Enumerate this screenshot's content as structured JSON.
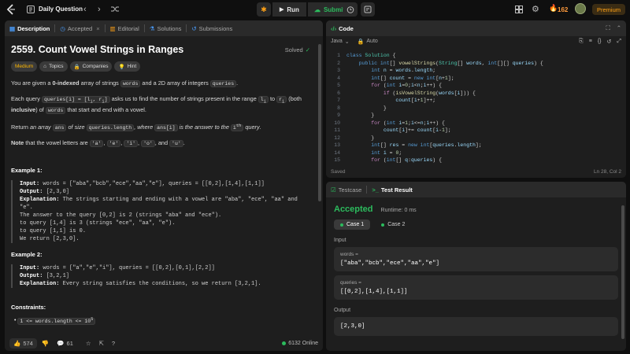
{
  "topbar": {
    "title": "Daily Question",
    "run_label": "Run",
    "submit_label": "Submit",
    "streak": "162",
    "premium_label": "Premium"
  },
  "left_tabs": [
    "Description",
    "Accepted",
    "Editorial",
    "Solutions",
    "Submissions"
  ],
  "problem": {
    "title": "2559. Count Vowel Strings in Ranges",
    "solved_label": "Solved",
    "difficulty": "Medium",
    "chips": [
      "Topics",
      "Companies",
      "Hint"
    ],
    "p1_a": "You are given a ",
    "p1_b": "0-indexed",
    "p1_c": " array of strings ",
    "p1_code1": "words",
    "p1_d": " and a 2D array of integers ",
    "p1_code2": "queries",
    "p1_e": ".",
    "p2_a": "Each query ",
    "p2_code1": "queries[i] = [l",
    "p2_code1_sub": "i",
    "p2_code1_b": ", r",
    "p2_code1_sub2": "i",
    "p2_code1_c": "]",
    "p2_b": " asks us to find the number of strings present in the range ",
    "p2_code2": "l",
    "p2_code2_sub": "i",
    "p2_c": " to ",
    "p2_code3": "r",
    "p2_code3_sub": "i",
    "p2_d": " (both ",
    "p2_e": "inclusive",
    "p2_f": ") of ",
    "p2_code4": "words",
    "p2_g": " that start and end with a vowel.",
    "p3_a": "Return ",
    "p3_b": "an array ",
    "p3_code1": "ans",
    "p3_c": " of size ",
    "p3_code2": "queries.length",
    "p3_d": ", where ",
    "p3_code3": "ans[i]",
    "p3_e": " is the answer to the ",
    "p3_code4": "i",
    "p3_sup": "th",
    "p3_f": " query",
    "p3_g": ".",
    "p4_a": "Note",
    "p4_b": " that the vowel letters are ",
    "vowels": [
      "'a'",
      "'e'",
      "'i'",
      "'o'",
      "'u'"
    ],
    "p4_and": ", and ",
    "p4_end": ".",
    "example1_title": "Example 1:",
    "ex1_input_label": "Input:",
    "ex1_input": " words = [\"aba\",\"bcb\",\"ece\",\"aa\",\"e\"], queries = [[0,2],[1,4],[1,1]]",
    "ex1_output_label": "Output:",
    "ex1_output": " [2,3,0]",
    "ex1_expl_label": "Explanation:",
    "ex1_expl": " The strings starting and ending with a vowel are \"aba\", \"ece\", \"aa\" and \"e\".",
    "ex1_line2": "The answer to the query [0,2] is 2 (strings \"aba\" and \"ece\").",
    "ex1_line3": "to query [1,4] is 3 (strings \"ece\", \"aa\", \"e\").",
    "ex1_line4": "to query [1,1] is 0.",
    "ex1_line5": "We return [2,3,0].",
    "example2_title": "Example 2:",
    "ex2_input_label": "Input:",
    "ex2_input": " words = [\"a\",\"e\",\"i\"], queries = [[0,2],[0,1],[2,2]]",
    "ex2_output_label": "Output:",
    "ex2_output": " [3,2,1]",
    "ex2_expl_label": "Explanation:",
    "ex2_expl": " Every string satisfies the conditions, so we return [3,2,1].",
    "constraints_title": "Constraints:",
    "constraint1_a": "1 <= words.length <= 10",
    "constraint1_sup": "5"
  },
  "left_footer": {
    "likes": "574",
    "comments": "61",
    "online": "6132 Online"
  },
  "code_panel": {
    "title": "Code",
    "language": "Java",
    "mode": "Auto",
    "saved": "Saved",
    "cursor": "Ln 28, Col 2",
    "lines": [
      {
        "n": "1",
        "html": "<span class='k'>class</span> <span class='t'>Solution</span> <span class='p'>{</span>"
      },
      {
        "n": "2",
        "html": "    <span class='k'>public</span> <span class='k'>int</span><span class='p'>[]</span> <span class='f'>vowelStrings</span><span class='p'>(</span><span class='t'>String</span><span class='p'>[]</span> <span class='v'>words</span><span class='p'>,</span> <span class='k'>int</span><span class='p'>[][]</span> <span class='v'>queries</span><span class='p'>) {</span>"
      },
      {
        "n": "3",
        "html": "        <span class='k'>int</span> <span class='v'>n</span> <span class='p'>=</span> <span class='v'>words</span><span class='p'>.</span><span class='v'>length</span><span class='p'>;</span>"
      },
      {
        "n": "4",
        "html": "        <span class='k'>int</span><span class='p'>[]</span> <span class='v'>count</span> <span class='p'>=</span> <span class='k'>new</span> <span class='k'>int</span><span class='p'>[</span><span class='v'>n</span><span class='p'>+</span><span class='n'>1</span><span class='p'>];</span>"
      },
      {
        "n": "5",
        "html": "        <span class='kc'>for</span> <span class='p'>(</span><span class='k'>int</span> <span class='v'>i</span><span class='p'>=</span><span class='n'>0</span><span class='p'>;</span><span class='v'>i</span><span class='p'>&lt;</span><span class='v'>n</span><span class='p'>;</span><span class='v'>i</span><span class='p'>++) {</span>"
      },
      {
        "n": "6",
        "html": "            <span class='kc'>if</span> <span class='p'>(</span><span class='f'>isVowelString</span><span class='p'>(</span><span class='v'>words</span><span class='p'>[</span><span class='v'>i</span><span class='p'>])) {</span>"
      },
      {
        "n": "7",
        "html": "                <span class='v'>count</span><span class='p'>[</span><span class='v'>i</span><span class='p'>+</span><span class='n'>1</span><span class='p'>]++;</span>"
      },
      {
        "n": "8",
        "html": "            <span class='p'>}</span>"
      },
      {
        "n": "9",
        "html": "        <span class='p'>}</span>"
      },
      {
        "n": "10",
        "html": "        <span class='kc'>for</span> <span class='p'>(</span><span class='k'>int</span> <span class='v'>i</span><span class='p'>=</span><span class='n'>1</span><span class='p'>;</span><span class='v'>i</span><span class='p'>&lt;=</span><span class='v'>n</span><span class='p'>;</span><span class='v'>i</span><span class='p'>++) {</span>"
      },
      {
        "n": "11",
        "html": "            <span class='v'>count</span><span class='p'>[</span><span class='v'>i</span><span class='p'>]+=</span> <span class='v'>count</span><span class='p'>[</span><span class='v'>i</span><span class='p'>-</span><span class='n'>1</span><span class='p'>];</span>"
      },
      {
        "n": "12",
        "html": "        <span class='p'>}</span>"
      },
      {
        "n": "13",
        "html": "        <span class='k'>int</span><span class='p'>[]</span> <span class='v'>res</span> <span class='p'>=</span> <span class='k'>new</span> <span class='k'>int</span><span class='p'>[</span><span class='v'>queries</span><span class='p'>.</span><span class='v'>length</span><span class='p'>];</span>"
      },
      {
        "n": "14",
        "html": "        <span class='k'>int</span> <span class='v'>i</span> <span class='p'>=</span> <span class='n'>0</span><span class='p'>;</span>"
      },
      {
        "n": "15",
        "html": "        <span class='kc'>for</span> <span class='p'>(</span><span class='k'>int</span><span class='p'>[]</span> <span class='v'>q</span><span class='p'>:</span><span class='v'>queries</span><span class='p'>) {</span>"
      }
    ]
  },
  "result_panel": {
    "tab_testcase": "Testcase",
    "tab_result": "Test Result",
    "status": "Accepted",
    "runtime": "Runtime: 0 ms",
    "case1": "Case 1",
    "case2": "Case 2",
    "input_label": "Input",
    "words_label": "words =",
    "words_value": "[\"aba\",\"bcb\",\"ece\",\"aa\",\"e\"]",
    "queries_label": "queries =",
    "queries_value": "[[0,2],[1,4],[1,1]]",
    "output_label": "Output",
    "output_value": "[2,3,0]"
  },
  "colors": {
    "accent_green": "#2cbb5d",
    "medium": "#ffb800",
    "accepted": "#2cbb5d",
    "premium": "#ffa116"
  }
}
